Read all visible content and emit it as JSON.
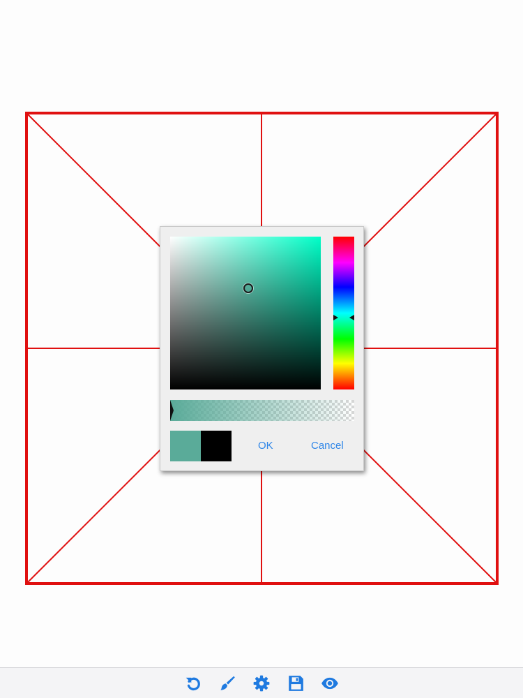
{
  "canvas": {
    "guide_color": "#e01010",
    "background": "#fdfdfd"
  },
  "color_picker": {
    "hue_color": "#00ffc8",
    "selected_color": "#5aab99",
    "previous_color": "#000000",
    "saturation": 0.52,
    "value": 0.66,
    "hue_position": 0.53,
    "alpha": 1.0,
    "ok_label": "OK",
    "cancel_label": "Cancel",
    "link_color": "#2f86e8"
  },
  "toolbar": {
    "icon_color": "#1f7ae0",
    "items": [
      {
        "name": "undo-icon"
      },
      {
        "name": "brush-icon"
      },
      {
        "name": "gear-icon"
      },
      {
        "name": "save-icon"
      },
      {
        "name": "eye-icon"
      }
    ]
  }
}
